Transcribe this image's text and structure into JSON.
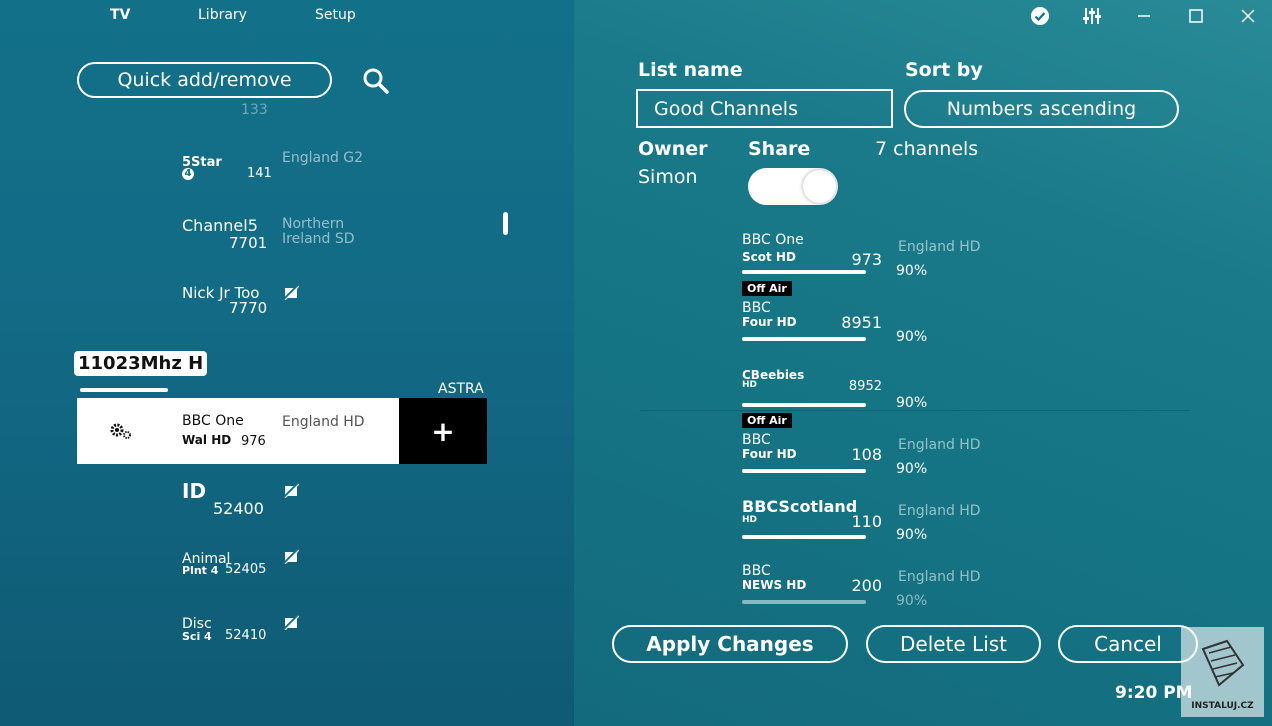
{
  "nav": {
    "tv": "TV",
    "library": "Library",
    "setup": "Setup"
  },
  "quick_add": "Quick add/remove",
  "left_channels": [
    {
      "logo_line1": "5Star",
      "logo_line2": "4",
      "number": "141",
      "region": "England G2"
    },
    {
      "logo_line1": "Channel5",
      "number": "7701",
      "region": "Northern Ireland SD"
    },
    {
      "logo_line1": "Nick Jr Too",
      "number": "7770"
    },
    {
      "logo_line1": "ID",
      "number": "52400"
    },
    {
      "logo_line1": "Animal",
      "logo_line2": "Plnt 4",
      "number": "52405"
    },
    {
      "logo_line1": "Disc",
      "logo_line2": "Sci 4",
      "number": "52410"
    }
  ],
  "top_partial_number": "133",
  "frequency": "11023Mhz H",
  "satellite": "ASTRA",
  "selected_channel": {
    "logo_line1": "BBC One",
    "logo_line2": "Wal HD",
    "number": "976",
    "region": "England HD"
  },
  "plus": "+",
  "right": {
    "list_name_label": "List name",
    "list_name_value": "Good Channels",
    "sort_label": "Sort by",
    "sort_value": "Numbers ascending",
    "owner_label": "Owner",
    "owner_value": "Simon",
    "share_label": "Share",
    "share_on": true,
    "channel_count": "7 channels",
    "channels": [
      {
        "logo1": "BBC One",
        "logo2": "Scot HD",
        "number": "973",
        "region": "England HD",
        "pct": "90%"
      },
      {
        "offair": "Off Air",
        "logo1": "BBC",
        "logo2": "Four HD",
        "number": "8951",
        "pct": "90%"
      },
      {
        "logo1": "CBeebies",
        "logo2": "HD",
        "number": "8952",
        "pct": "90%"
      },
      {
        "offair": "Off Air",
        "logo1": "BBC",
        "logo2": "Four HD",
        "number": "108",
        "region": "England HD",
        "pct": "90%"
      },
      {
        "logo1": "BBCScotland",
        "logo2": "HD",
        "number": "110",
        "region": "England HD",
        "pct": "90%"
      },
      {
        "logo1": "BBC",
        "logo2": "NEWS HD",
        "number": "200",
        "region": "England HD",
        "pct": "90%"
      }
    ]
  },
  "buttons": {
    "apply": "Apply Changes",
    "delete": "Delete List",
    "cancel": "Cancel"
  },
  "clock": "9:20 PM",
  "corner_logo_text": "INSTALUJ.CZ",
  "icons": [
    "check-circle-icon",
    "equalizer-icon",
    "minimize-icon",
    "maximize-icon",
    "close-icon",
    "search-icon",
    "gear-icon",
    "no-signal-icon"
  ]
}
